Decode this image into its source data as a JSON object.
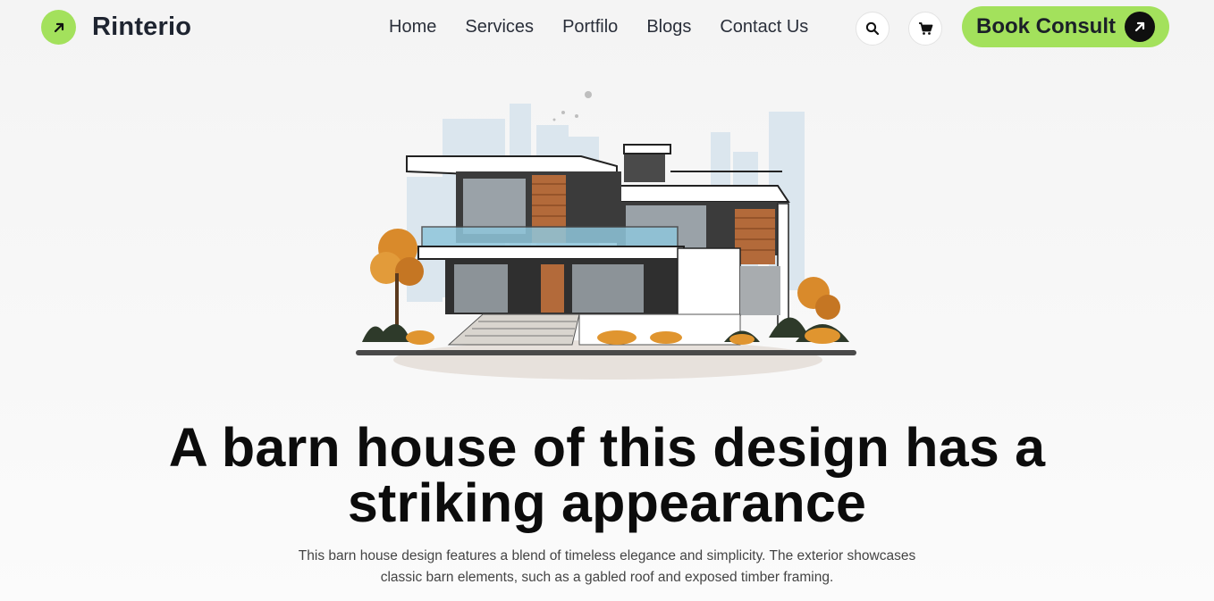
{
  "brand": {
    "name": "Rinterio",
    "accent_color": "#a3e15c",
    "logo_icon": "arrow-up-right-icon"
  },
  "nav": {
    "items": [
      {
        "label": "Home"
      },
      {
        "label": "Services"
      },
      {
        "label": "Portfilo"
      },
      {
        "label": "Blogs"
      },
      {
        "label": "Contact Us"
      }
    ]
  },
  "header_actions": {
    "search_icon": "search-icon",
    "cart_icon": "cart-icon"
  },
  "cta": {
    "label": "Book Consult",
    "icon": "arrow-up-right-icon"
  },
  "hero": {
    "headline_line1": "A barn house of this design has a",
    "headline_line2": "striking appearance",
    "description_line1": "This barn house design features a blend of timeless elegance and simplicity. The exterior showcases",
    "description_line2": "classic barn elements, such as a gabled roof and exposed timber framing."
  }
}
